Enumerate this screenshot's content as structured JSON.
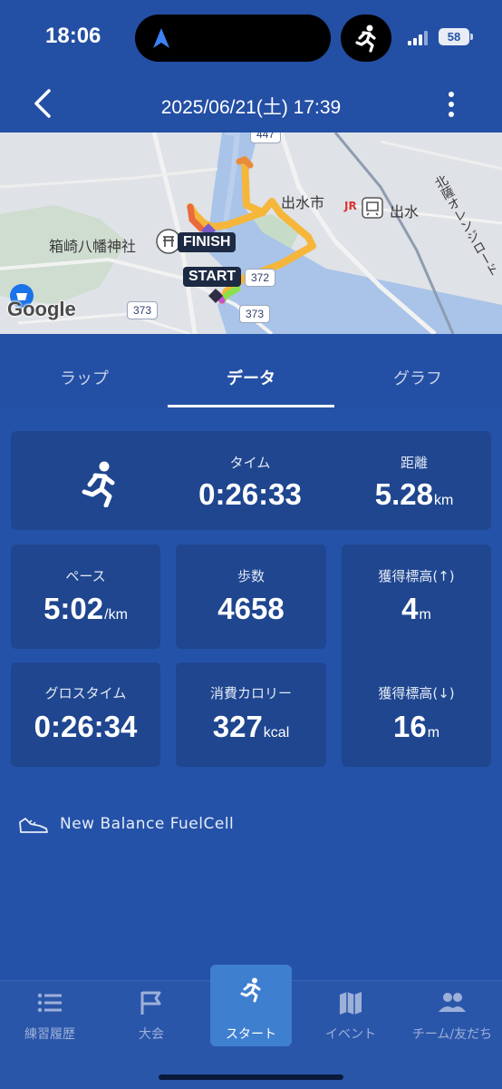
{
  "status_bar": {
    "time": "18:06",
    "battery": "58",
    "icons": [
      "location-arrow-icon",
      "running-activity-icon",
      "signal-icon",
      "battery-icon"
    ]
  },
  "header": {
    "title": "2025/06/21(土) 17:39",
    "back_icon": "chevron-left-icon",
    "more_icon": "more-vertical-icon"
  },
  "map": {
    "labels": {
      "city": "出水市",
      "station_jr": "JR",
      "station": "出水",
      "shrine": "箱崎八幡神社",
      "railway": "北薩オレンジロード"
    },
    "routes": [
      "447",
      "372",
      "373",
      "373"
    ],
    "finish": "FINISH",
    "start": "START",
    "google": "Google"
  },
  "tabs": [
    {
      "label": "ラップ",
      "active": false
    },
    {
      "label": "データ",
      "active": true
    },
    {
      "label": "グラフ",
      "active": false
    }
  ],
  "stats": {
    "time": {
      "label": "タイム",
      "value": "0:26:33"
    },
    "distance": {
      "label": "距離",
      "value": "5.28",
      "unit": "km"
    },
    "pace": {
      "label": "ペース",
      "value": "5:02",
      "unit": "/km"
    },
    "steps": {
      "label": "歩数",
      "value": "4658"
    },
    "elev_up": {
      "label": "獲得標高(↑)",
      "value": "4",
      "unit": "m"
    },
    "gross_time": {
      "label": "グロスタイム",
      "value": "0:26:34"
    },
    "calories": {
      "label": "消費カロリー",
      "value": "327",
      "unit": "kcal"
    },
    "elev_down": {
      "label": "獲得標高(↓)",
      "value": "16",
      "unit": "m"
    }
  },
  "shoe": {
    "name": "New Balance FuelCell",
    "icon": "shoe-icon"
  },
  "bottom_nav": [
    {
      "label": "練習履歴",
      "icon": "list-icon",
      "active": false
    },
    {
      "label": "大会",
      "icon": "flag-icon",
      "active": false
    },
    {
      "label": "スタート",
      "icon": "runner-icon",
      "active": true
    },
    {
      "label": "イベント",
      "icon": "map-icon",
      "active": false
    },
    {
      "label": "チーム/友だち",
      "icon": "people-icon",
      "active": false
    }
  ],
  "colors": {
    "background": "#2452a8",
    "card": "#1f468f",
    "active_nav": "#3f7fd0",
    "route": "#f5b63a"
  }
}
